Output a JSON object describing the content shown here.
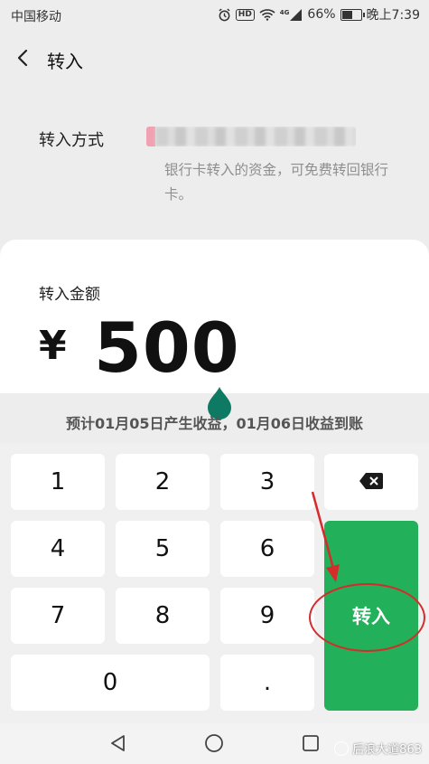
{
  "status_bar": {
    "carrier": "中国移动",
    "network": "4G",
    "battery": "66%",
    "battery_fraction": 0.66,
    "time": "晚上7:39",
    "icons": [
      "alarm-icon",
      "hd-icon",
      "wifi-icon",
      "signal-icon",
      "battery-icon"
    ]
  },
  "header": {
    "title": "转入"
  },
  "method": {
    "label": "转入方式",
    "note": "银行卡转入的资金，可免费转回银行卡。"
  },
  "amount": {
    "label": "转入金额",
    "currency": "¥",
    "value": "500"
  },
  "earnings_note": "预计01月05日产生收益，01月06日收益到账",
  "keypad": {
    "keys": [
      "1",
      "2",
      "3",
      "4",
      "5",
      "6",
      "7",
      "8",
      "9",
      "0",
      "."
    ],
    "submit_label": "转入"
  },
  "watermark": {
    "text": "后浪大道863"
  },
  "colors": {
    "accent": "#22b05a",
    "annotation": "#d62b2b",
    "drop": "#0f7a63"
  }
}
